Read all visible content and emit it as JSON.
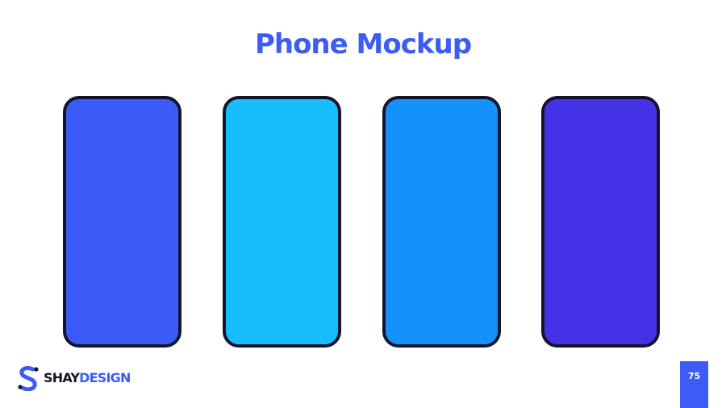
{
  "slide": {
    "title": "Phone Mockup",
    "page_number": "75"
  },
  "phones": [
    {
      "screen_color": "#3b5bf6"
    },
    {
      "screen_color": "#18bdfd"
    },
    {
      "screen_color": "#1592fa"
    },
    {
      "screen_color": "#4632e6"
    }
  ],
  "brand": {
    "name_part1": "SHAY",
    "name_part2": "DESIGN",
    "primary_color": "#3d5cf5",
    "dark_color": "#15142a",
    "logo_icon": "s-monogram-icon"
  }
}
